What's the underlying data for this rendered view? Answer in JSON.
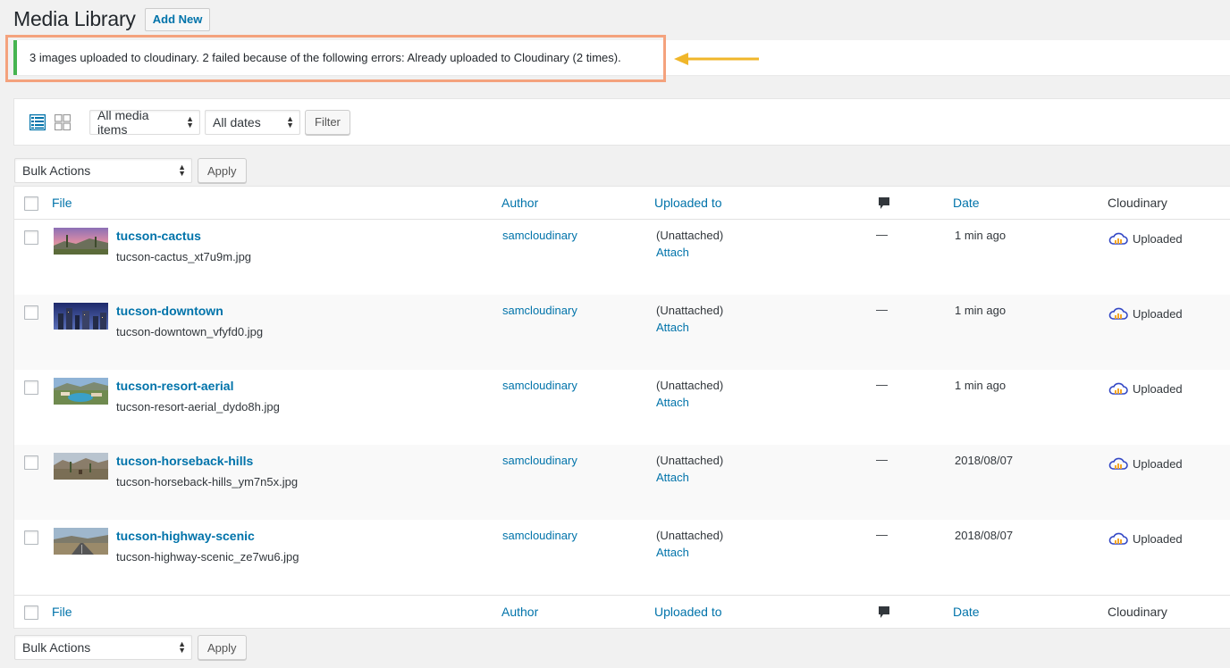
{
  "header": {
    "title": "Media Library",
    "add_new": "Add New"
  },
  "notice": {
    "message": "3 images uploaded to cloudinary. 2 failed because of the following errors: Already uploaded to Cloudinary (2 times)."
  },
  "filters": {
    "media_type": "All media items",
    "dates": "All dates",
    "filter_label": "Filter"
  },
  "bulk": {
    "label": "Bulk Actions",
    "apply": "Apply"
  },
  "columns": {
    "file": "File",
    "author": "Author",
    "uploaded_to": "Uploaded to",
    "date": "Date",
    "cloudinary": "Cloudinary"
  },
  "rows": [
    {
      "title": "tucson-cactus",
      "filename": "tucson-cactus_xt7u9m.jpg",
      "author": "samcloudinary",
      "uploaded_to": "(Unattached)",
      "attach": "Attach",
      "comments": "—",
      "date": "1 min ago",
      "cloudinary": "Uploaded"
    },
    {
      "title": "tucson-downtown",
      "filename": "tucson-downtown_vfyfd0.jpg",
      "author": "samcloudinary",
      "uploaded_to": "(Unattached)",
      "attach": "Attach",
      "comments": "—",
      "date": "1 min ago",
      "cloudinary": "Uploaded"
    },
    {
      "title": "tucson-resort-aerial",
      "filename": "tucson-resort-aerial_dydo8h.jpg",
      "author": "samcloudinary",
      "uploaded_to": "(Unattached)",
      "attach": "Attach",
      "comments": "—",
      "date": "1 min ago",
      "cloudinary": "Uploaded"
    },
    {
      "title": "tucson-horseback-hills",
      "filename": "tucson-horseback-hills_ym7n5x.jpg",
      "author": "samcloudinary",
      "uploaded_to": "(Unattached)",
      "attach": "Attach",
      "comments": "—",
      "date": "2018/08/07",
      "cloudinary": "Uploaded"
    },
    {
      "title": "tucson-highway-scenic",
      "filename": "tucson-highway-scenic_ze7wu6.jpg",
      "author": "samcloudinary",
      "uploaded_to": "(Unattached)",
      "attach": "Attach",
      "comments": "—",
      "date": "2018/08/07",
      "cloudinary": "Uploaded"
    }
  ],
  "icons": {
    "list_view": "list-view-icon",
    "grid_view": "grid-view-icon",
    "comment": "comment-bubble-icon",
    "cloud": "cloudinary-cloud-icon",
    "arrow": "pointer-arrow-icon"
  },
  "colors": {
    "link": "#0073aa",
    "notice_border": "#46b450",
    "highlight": "#f4a27d",
    "arrow": "#f0b62a"
  }
}
